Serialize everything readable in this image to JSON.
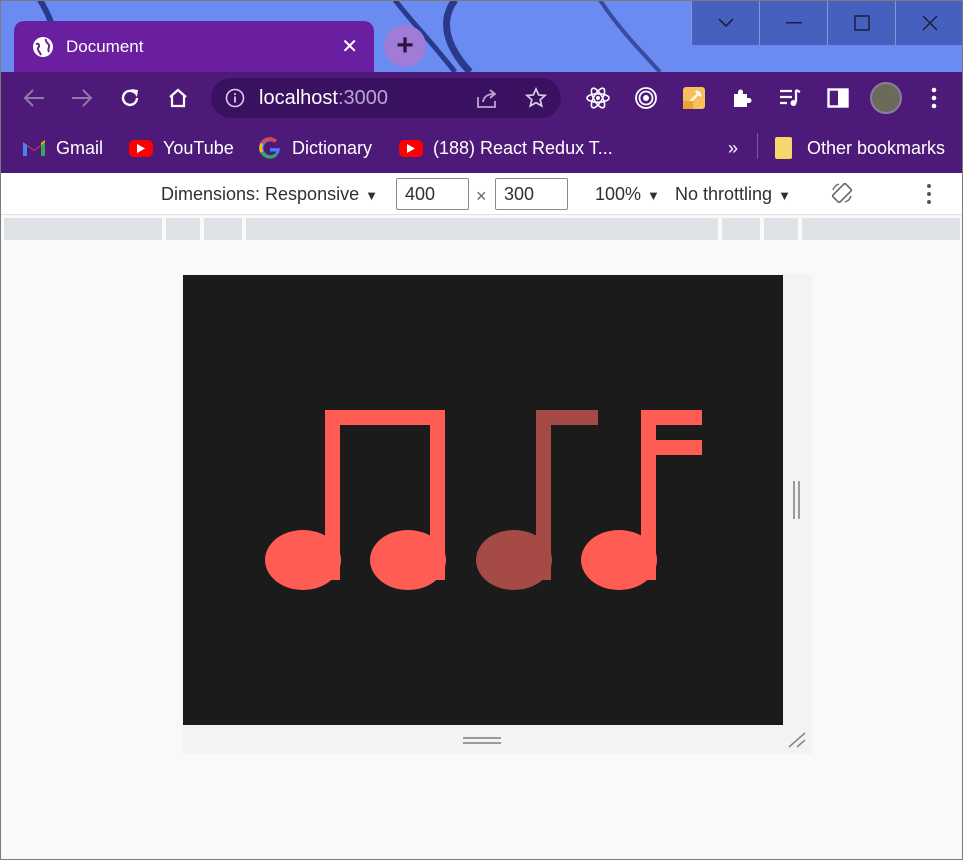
{
  "window": {
    "controls": [
      "chevron-down",
      "minimize",
      "maximize",
      "close"
    ]
  },
  "tab": {
    "title": "Document",
    "icon": "globe-icon",
    "close_glyph": "✕"
  },
  "new_tab": {
    "glyph": "+"
  },
  "omnibox": {
    "host": "localhost",
    "port": ":3000"
  },
  "bookmarks": {
    "items": [
      {
        "label": "Gmail",
        "icon": "gmail-icon"
      },
      {
        "label": "YouTube",
        "icon": "youtube-icon"
      },
      {
        "label": "Dictionary",
        "icon": "google-icon"
      },
      {
        "label": "(188) React Redux T...",
        "icon": "youtube-icon"
      }
    ],
    "overflow": "»",
    "other": "Other bookmarks"
  },
  "devtools": {
    "dimensions_label": "Dimensions: Responsive",
    "width": "400",
    "times": "×",
    "height": "300",
    "zoom": "100%",
    "throttling": "No throttling"
  },
  "page": {
    "background": "#1b1b1b",
    "notes": [
      {
        "name": "beamed-eighth-notes",
        "color": "#ff5c54"
      },
      {
        "name": "eighth-note-dim",
        "color": "#a54a45"
      },
      {
        "name": "sixteenth-note",
        "color": "#ff5c54"
      }
    ]
  },
  "colors": {
    "tab": "#6a1fa0",
    "toolbar": "#4e1a7a",
    "wallpaper": "#6a8cf2"
  }
}
